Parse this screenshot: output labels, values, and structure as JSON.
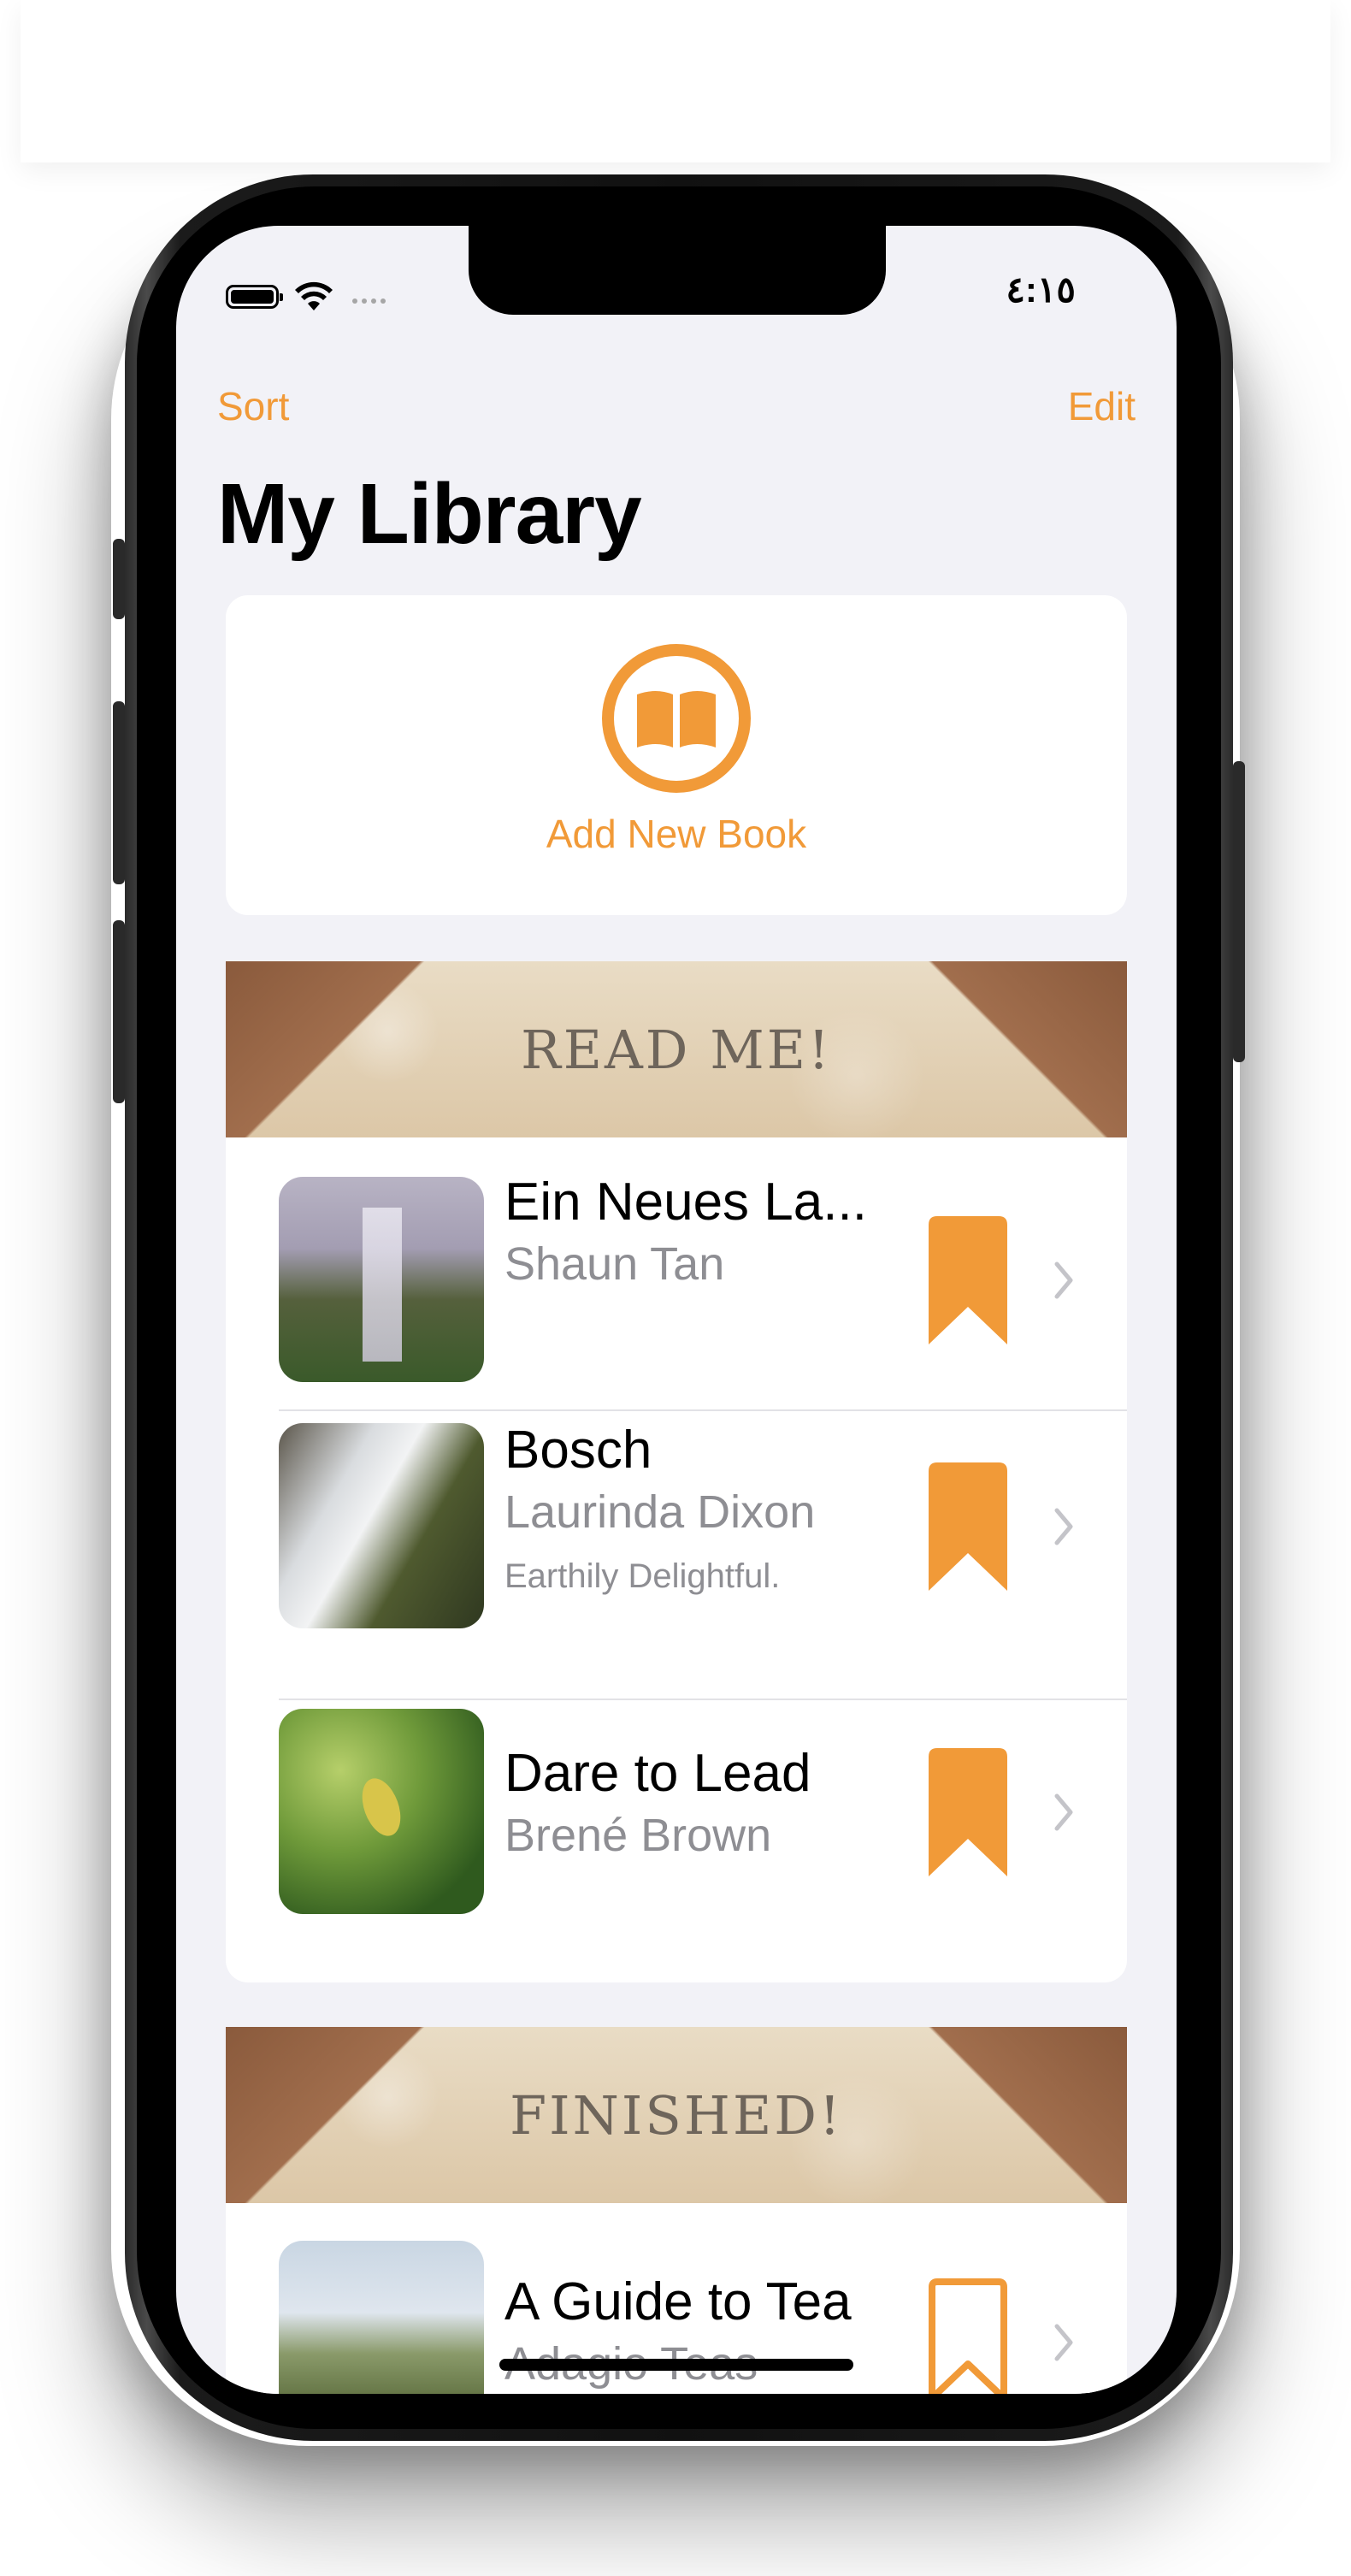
{
  "status_bar": {
    "time": "٤:١٥"
  },
  "nav": {
    "left_label": "Sort",
    "right_label": "Edit"
  },
  "title": "My Library",
  "add_card": {
    "label": "Add New Book",
    "icon": "book-open-icon"
  },
  "sections": [
    {
      "header": "READ ME!",
      "books": [
        {
          "title": "Ein Neues La...",
          "author": "Shaun Tan",
          "note": "",
          "bookmarked": true
        },
        {
          "title": "Bosch",
          "author": "Laurinda Dixon",
          "note": "Earthily Delightful.",
          "bookmarked": true
        },
        {
          "title": "Dare to Lead",
          "author": "Brené Brown",
          "note": "",
          "bookmarked": true
        }
      ]
    },
    {
      "header": "FINISHED!",
      "books": [
        {
          "title": "A Guide to Tea",
          "author": "Adagio Teas",
          "note": "",
          "bookmarked": false
        }
      ]
    }
  ],
  "colors": {
    "accent": "#f19a38",
    "background": "#f2f2f7",
    "secondary_text": "#8e8e93"
  }
}
